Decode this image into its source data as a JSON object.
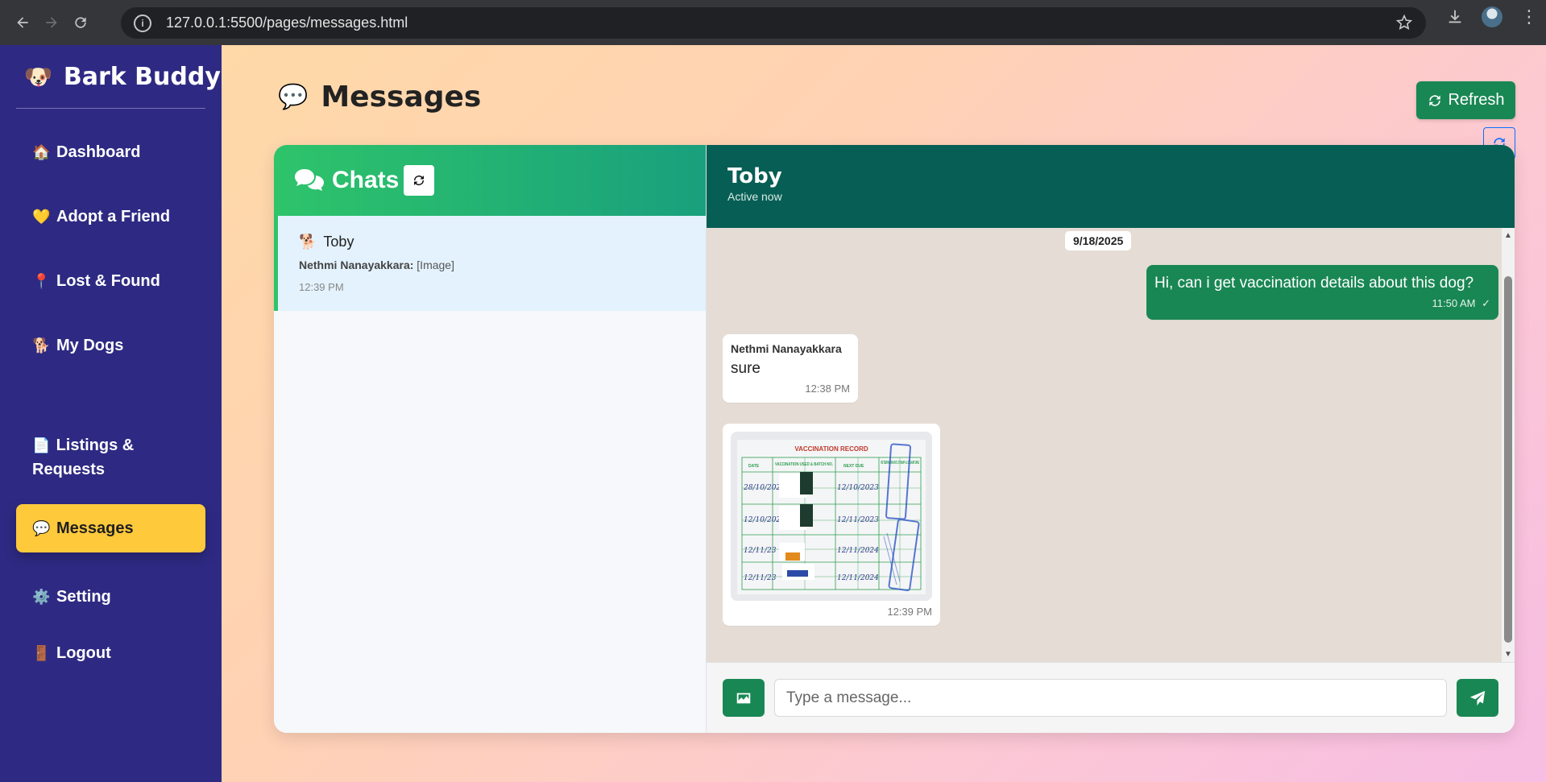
{
  "browser": {
    "url": "127.0.0.1:5500/pages/messages.html",
    "info_glyph": "i",
    "menu_glyph": "⋮"
  },
  "sidebar": {
    "brand_logo": "🐶",
    "brand_name": "Bark Buddy",
    "items": [
      {
        "icon": "🏠",
        "label": "Dashboard"
      },
      {
        "icon": "💛",
        "label": "Adopt a Friend"
      },
      {
        "icon": "📍",
        "label": "Lost & Found"
      },
      {
        "icon": "🐕",
        "label": "My Dogs"
      },
      {
        "icon": "📄",
        "label": "Listings & Requests"
      },
      {
        "icon": "💬",
        "label": "Messages",
        "active": true
      },
      {
        "icon": "⚙️",
        "label": "Setting"
      },
      {
        "icon": "🚪",
        "label": "Logout"
      }
    ]
  },
  "page": {
    "title_icon": "💬",
    "title": "Messages",
    "refresh_label": "Refresh"
  },
  "chat_list": {
    "title": "Chats",
    "conversations": [
      {
        "icon": "🐕",
        "name": "Toby",
        "preview_sender": "Nethmi Nanayakkara:",
        "preview_text": "[Image]",
        "time": "12:39 PM",
        "selected": true
      }
    ]
  },
  "chat": {
    "name": "Toby",
    "status": "Active now",
    "date_chip": "9/18/2025",
    "messages": [
      {
        "direction": "out",
        "text": "Hi, can i get vaccination details about this dog?",
        "time": "11:50 AM",
        "status_icon": "✓"
      },
      {
        "direction": "in",
        "sender": "Nethmi Nanayakkara",
        "text": "sure",
        "time": "12:38 PM"
      },
      {
        "direction": "in",
        "type": "image",
        "time": "12:39 PM",
        "image_text": {
          "heading": "VACCINATION RECORD",
          "columns": [
            "DATE",
            "VACCINATION USED & BATCH NO.",
            "NEXT DUE",
            "VETERINARIAN'S STAMP & SIGNATURE"
          ],
          "rows": [
            {
              "date": "28/10/2022",
              "next_due": "12/10/2023"
            },
            {
              "date": "12/10/2023",
              "next_due": "12/11/2023"
            },
            {
              "date": "12/11/23",
              "next_due": "12/11/2024"
            },
            {
              "date": "12/11/23",
              "next_due": "12/11/2024"
            }
          ]
        }
      }
    ],
    "composer": {
      "placeholder": "Type a message..."
    }
  },
  "colors": {
    "sidebar_bg": "#2e2a83",
    "active_nav": "#ffc93c",
    "primary_green": "#198754",
    "chat_header": "#075e54",
    "chat_bg": "#e5ddd5",
    "selected_conversation": "#e3f2fd"
  }
}
